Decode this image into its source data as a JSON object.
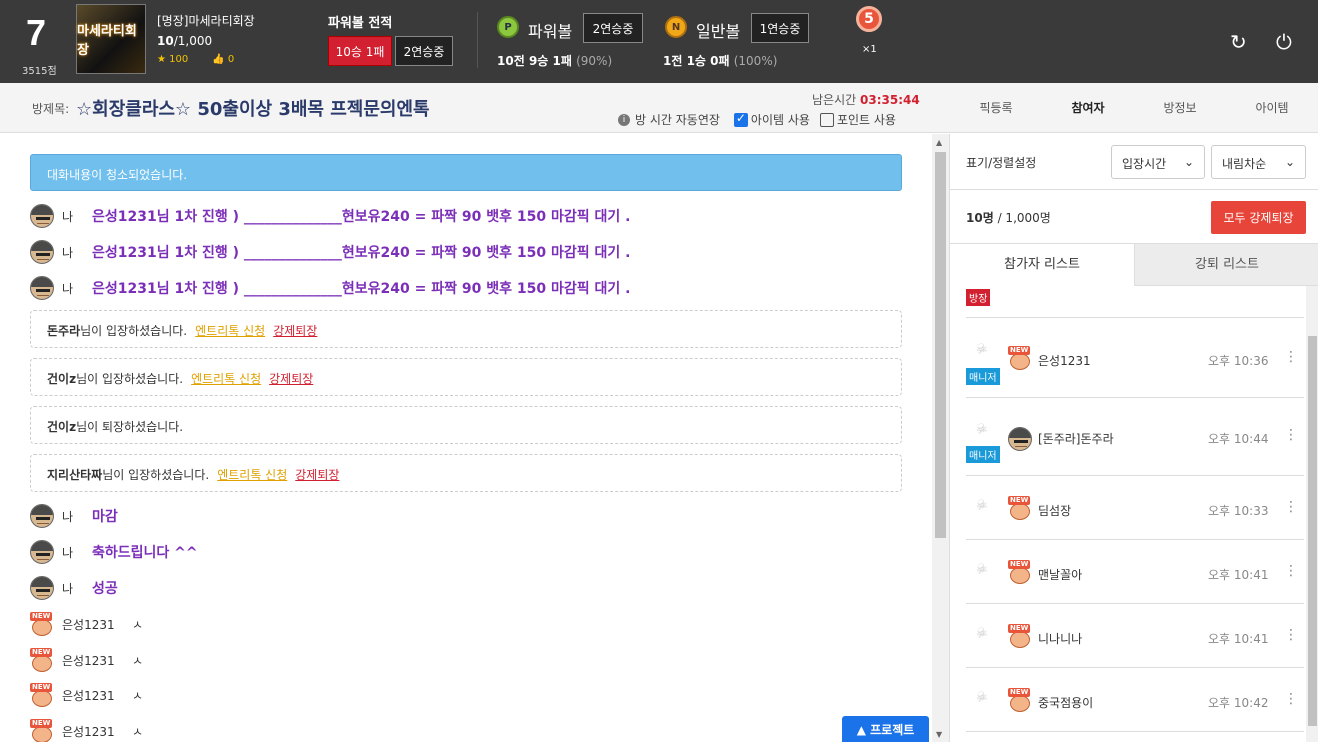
{
  "header": {
    "level": "7",
    "points": "3515점",
    "avatar_text": "마세라티회장",
    "username": "[명장]마세라티회장",
    "members_current": "10",
    "members_max": "/1,000",
    "stars": "100",
    "likes": "0",
    "pb_record_label": "파워볼 전적",
    "pb_record": "10승 1패",
    "pb_streak": "2연승중",
    "powerball": {
      "badge": "P",
      "label": "파워볼",
      "streak": "2연승중",
      "games": "10전",
      "wins": "9승",
      "losses": "1패",
      "pct": "(90%)"
    },
    "normalball": {
      "badge": "N",
      "label": "일반볼",
      "streak": "1연승중",
      "games": "1전",
      "wins": "1승",
      "losses": "0패",
      "pct": "(100%)"
    },
    "medal_num": "5",
    "medal_mult": "×1",
    "refresh_icon": "↻",
    "power_icon": "⏻"
  },
  "room": {
    "title_label": "방제목:",
    "title": "☆회장클라스☆ 50출이상 3배목 프젝문의엔톡",
    "remain_label": "남은시간",
    "remain_time": "03:35:44",
    "auto_extend": "방 시간 자동연장",
    "item_use": "아이템 사용",
    "point_use": "포인트 사용",
    "tabs": [
      "픽등록",
      "참여자",
      "방정보",
      "아이템"
    ]
  },
  "chat": {
    "cleared": "대화내용이 청소되었습니다.",
    "me": "나",
    "pick_msg": "은성1231님 1차 진행 ) ______________현보유240 = 파짝 90 뱃후 150 마감픽 대기 .",
    "sys1_user": "돈주라",
    "sys2_user": "건이z",
    "sys3_user": "건이z",
    "sys4_user": "지리산타짜",
    "enter_text": "님이 입장하셨습니다.",
    "leave_text": "님이 퇴장하셨습니다.",
    "entry_req": "엔트리톡 신청",
    "kick": "강제퇴장",
    "m1": "마감",
    "m2": "축하드립니다 ^^",
    "m3": "성공",
    "user": "은성1231",
    "user_msg": "ㅅ",
    "project_btn": "▲ 프로젝트"
  },
  "side": {
    "sort_label": "표기/정렬설정",
    "sort1": "입장시간",
    "sort2": "내림차순",
    "count": "10명",
    "count_max": "/ 1,000명",
    "kick_all": "모두 강제퇴장",
    "tab_participants": "참가자 리스트",
    "tab_kicked": "강퇴 리스트",
    "host_badge": "방장",
    "mgr_badge": "매니저",
    "p1_name": "은성1231",
    "p1_time": "오후 10:36",
    "p2_name": "[돈주라]돈주라",
    "p2_time": "오후 10:44",
    "p3_name": "딤섬장",
    "p3_time": "오후 10:33",
    "p4_name": "맨날꼴아",
    "p4_time": "오후 10:41",
    "p5_name": "니나니나",
    "p5_time": "오후 10:41",
    "p6_name": "중국점용이",
    "p6_time": "오후 10:42"
  }
}
